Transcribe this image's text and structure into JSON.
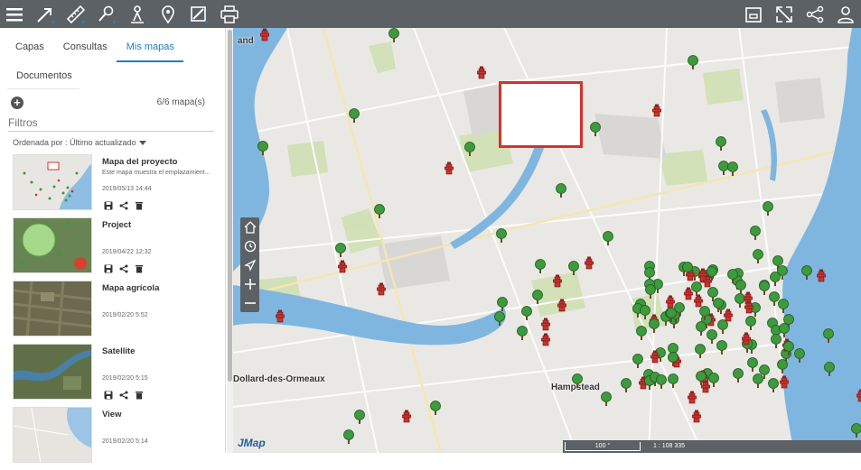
{
  "toolbar": {
    "left_icons": [
      "menu-icon",
      "arrow-measure-icon",
      "ruler-icon",
      "location-pin-icon",
      "person-icon",
      "map-pin-icon",
      "draw-icon",
      "print-icon"
    ],
    "right_icons": [
      "frame-icon",
      "fullscreen-icon",
      "share-icon",
      "user-icon"
    ]
  },
  "panel": {
    "tabs": [
      "Capas",
      "Consultas",
      "Mis mapas"
    ],
    "active_tab": "Mis mapas",
    "second_tab": "Documentos",
    "count": "6/6 mapa(s)",
    "filter_placeholder": "Filtros",
    "sort_label": "Ordenada por : Último actualizado"
  },
  "maps": [
    {
      "title": "Mapa del proyecto",
      "desc": "Este mapa muestra el emplazamient...",
      "date": "2019/05/13 14:44"
    },
    {
      "title": "Project",
      "desc": "",
      "date": "2019/04/22 12:32"
    },
    {
      "title": "Mapa agrícola",
      "desc": "",
      "date": "2019/02/20 5:52"
    },
    {
      "title": "Satellite",
      "desc": "",
      "date": "2019/02/20 5:15"
    },
    {
      "title": "View",
      "desc": "",
      "date": "2019/02/20 5:14"
    }
  ],
  "map": {
    "labels": {
      "dollard": "Dollard-des-Ormeaux",
      "hampstead": "Hampstead",
      "top_left": "and"
    },
    "logo": "JMap",
    "scale_text": "100 °",
    "scale_ratio": "1 : 108 335",
    "colors": {
      "water": "#7fb6e0",
      "land": "#eae8e4",
      "park": "#cfe0b3",
      "tree": "#3d9a3d",
      "hydrant": "#c9322f",
      "toolbar": "#5b6165",
      "accent": "#1f7ec2"
    }
  }
}
